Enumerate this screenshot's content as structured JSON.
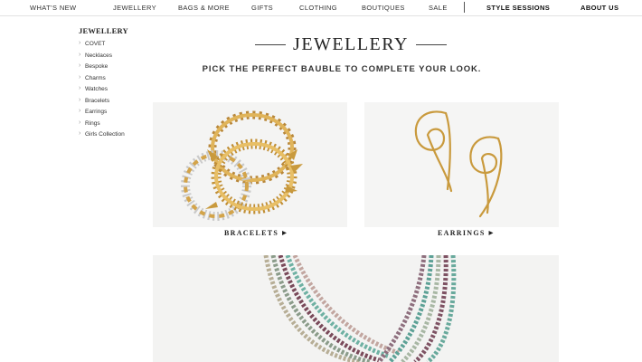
{
  "topnav": {
    "items": [
      "WHAT'S NEW",
      "JEWELLERY",
      "BAGS & MORE",
      "GIFTS",
      "CLOTHING",
      "BOUTIQUES",
      "SALE"
    ],
    "style_sessions": "STYLE SESSIONS",
    "about_us": "ABOUT US"
  },
  "sidebar": {
    "title": "JEWELLERY",
    "items": [
      "COVET",
      "Necklaces",
      "Bespoke",
      "Charms",
      "Watches",
      "Bracelets",
      "Earrings",
      "Rings",
      "Girls Collection"
    ]
  },
  "main": {
    "title": "JEWELLERY",
    "subtitle": "PICK THE PERFECT BAUBLE TO COMPLETE YOUR LOOK.",
    "tiles": [
      {
        "label": "BRACELETS",
        "arrow": "▶"
      },
      {
        "label": "EARRINGS",
        "arrow": "▶"
      }
    ]
  },
  "colors": {
    "gold": "#c99a3d",
    "silver": "#b9b9b9",
    "tile_background": "#f4f4f3"
  }
}
